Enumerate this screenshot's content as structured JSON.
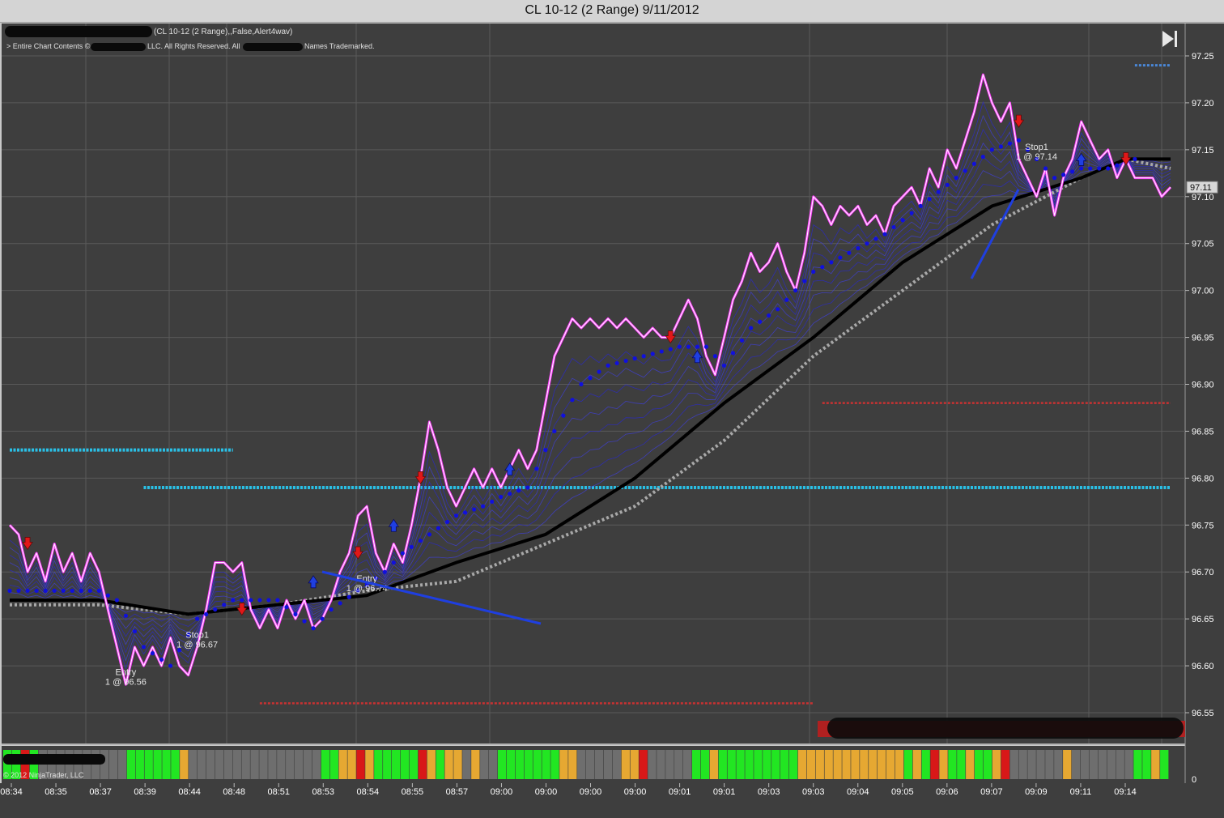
{
  "window": {
    "title": "CL 10-12 (2 Range)  9/11/2012"
  },
  "header": {
    "indicator_text": "(CL 10-12 (2 Range),,False,Alert4wav)",
    "copyright_left": "> Entire Chart Contents ©",
    "copyright_mid": "LLC. All Rights Reserved. All",
    "copyright_right": "Names Trademarked.",
    "ninjatrader_copyright": "© 2012 NinjaTrader, LLC"
  },
  "controls": {
    "jump_to_end_icon": "skip-to-end-icon"
  },
  "colors": {
    "panel_bg": "#3e3e3e",
    "price_line": "#ff3cff",
    "ma_black": "#000000",
    "ma_gray": "#a8a8a8",
    "dots_blue": "#1010dd",
    "level_cyan": "#2ac0e6",
    "level_red": "#c83232",
    "arrow_up": "#1f3fe0",
    "arrow_down": "#e01818",
    "bar_green": "#22e622",
    "bar_orange": "#e6a832",
    "bar_red": "#d81818",
    "bar_gray": "#6e6e6e"
  },
  "chart_data": {
    "type": "line",
    "title": "CL 10-12 (2 Range)  9/11/2012",
    "y_axis": {
      "ticks": [
        "97.25",
        "97.20",
        "97.15",
        "97.10",
        "97.05",
        "97.00",
        "96.95",
        "96.90",
        "96.85",
        "96.80",
        "96.75",
        "96.70",
        "96.65",
        "96.60",
        "96.55"
      ],
      "range": [
        96.52,
        97.27
      ],
      "last_price_label": "97.11"
    },
    "x_axis": {
      "ticks": [
        "08:34",
        "08:35",
        "08:37",
        "08:39",
        "08:44",
        "08:48",
        "08:51",
        "08:53",
        "08:54",
        "08:55",
        "08:57",
        "09:00",
        "09:00",
        "09:00",
        "09:00",
        "09:01",
        "09:01",
        "09:03",
        "09:03",
        "09:04",
        "09:05",
        "09:06",
        "09:07",
        "09:09",
        "09:11",
        "09:14"
      ]
    },
    "indicator_axis_label": "0",
    "series": [
      {
        "name": "price",
        "points": [
          [
            0,
            96.75
          ],
          [
            1,
            96.74
          ],
          [
            2,
            96.7
          ],
          [
            3,
            96.72
          ],
          [
            4,
            96.69
          ],
          [
            5,
            96.73
          ],
          [
            6,
            96.7
          ],
          [
            7,
            96.72
          ],
          [
            8,
            96.69
          ],
          [
            9,
            96.72
          ],
          [
            10,
            96.7
          ],
          [
            11,
            96.66
          ],
          [
            12,
            96.62
          ],
          [
            13,
            96.58
          ],
          [
            14,
            96.62
          ],
          [
            15,
            96.6
          ],
          [
            16,
            96.62
          ],
          [
            17,
            96.6
          ],
          [
            18,
            96.63
          ],
          [
            19,
            96.6
          ],
          [
            20,
            96.59
          ],
          [
            21,
            96.62
          ],
          [
            22,
            96.66
          ],
          [
            23,
            96.71
          ],
          [
            24,
            96.71
          ],
          [
            25,
            96.7
          ],
          [
            26,
            96.71
          ],
          [
            27,
            96.66
          ],
          [
            28,
            96.64
          ],
          [
            29,
            96.66
          ],
          [
            30,
            96.64
          ],
          [
            31,
            96.67
          ],
          [
            32,
            96.65
          ],
          [
            33,
            96.67
          ],
          [
            34,
            96.64
          ],
          [
            35,
            96.65
          ],
          [
            36,
            96.67
          ],
          [
            37,
            96.7
          ],
          [
            38,
            96.72
          ],
          [
            39,
            96.76
          ],
          [
            40,
            96.77
          ],
          [
            41,
            96.72
          ],
          [
            42,
            96.7
          ],
          [
            43,
            96.73
          ],
          [
            44,
            96.71
          ],
          [
            45,
            96.75
          ],
          [
            46,
            96.8
          ],
          [
            47,
            96.86
          ],
          [
            48,
            96.83
          ],
          [
            49,
            96.79
          ],
          [
            50,
            96.77
          ],
          [
            51,
            96.79
          ],
          [
            52,
            96.81
          ],
          [
            53,
            96.79
          ],
          [
            54,
            96.81
          ],
          [
            55,
            96.79
          ],
          [
            56,
            96.81
          ],
          [
            57,
            96.83
          ],
          [
            58,
            96.81
          ],
          [
            59,
            96.83
          ],
          [
            60,
            96.88
          ],
          [
            61,
            96.93
          ],
          [
            62,
            96.95
          ],
          [
            63,
            96.97
          ],
          [
            64,
            96.96
          ],
          [
            65,
            96.97
          ],
          [
            66,
            96.96
          ],
          [
            67,
            96.97
          ],
          [
            68,
            96.96
          ],
          [
            69,
            96.97
          ],
          [
            70,
            96.96
          ],
          [
            71,
            96.95
          ],
          [
            72,
            96.96
          ],
          [
            73,
            96.95
          ],
          [
            74,
            96.95
          ],
          [
            75,
            96.97
          ],
          [
            76,
            96.99
          ],
          [
            77,
            96.97
          ],
          [
            78,
            96.93
          ],
          [
            79,
            96.91
          ],
          [
            80,
            96.95
          ],
          [
            81,
            96.99
          ],
          [
            82,
            97.01
          ],
          [
            83,
            97.04
          ],
          [
            84,
            97.02
          ],
          [
            85,
            97.03
          ],
          [
            86,
            97.05
          ],
          [
            87,
            97.02
          ],
          [
            88,
            97.0
          ],
          [
            89,
            97.04
          ],
          [
            90,
            97.1
          ],
          [
            91,
            97.09
          ],
          [
            92,
            97.07
          ],
          [
            93,
            97.09
          ],
          [
            94,
            97.08
          ],
          [
            95,
            97.09
          ],
          [
            96,
            97.07
          ],
          [
            97,
            97.08
          ],
          [
            98,
            97.06
          ],
          [
            99,
            97.09
          ],
          [
            100,
            97.1
          ],
          [
            101,
            97.11
          ],
          [
            102,
            97.09
          ],
          [
            103,
            97.13
          ],
          [
            104,
            97.11
          ],
          [
            105,
            97.15
          ],
          [
            106,
            97.13
          ],
          [
            107,
            97.16
          ],
          [
            108,
            97.19
          ],
          [
            109,
            97.23
          ],
          [
            110,
            97.2
          ],
          [
            111,
            97.18
          ],
          [
            112,
            97.2
          ],
          [
            113,
            97.14
          ],
          [
            114,
            97.12
          ],
          [
            115,
            97.1
          ],
          [
            116,
            97.13
          ],
          [
            117,
            97.08
          ],
          [
            118,
            97.12
          ],
          [
            119,
            97.14
          ],
          [
            120,
            97.18
          ],
          [
            121,
            97.16
          ],
          [
            122,
            97.14
          ],
          [
            123,
            97.15
          ],
          [
            124,
            97.12
          ],
          [
            125,
            97.14
          ],
          [
            126,
            97.12
          ],
          [
            127,
            97.12
          ],
          [
            128,
            97.12
          ],
          [
            129,
            97.1
          ],
          [
            130,
            97.11
          ]
        ]
      },
      {
        "name": "ma_black",
        "points": [
          [
            0,
            96.67
          ],
          [
            10,
            96.67
          ],
          [
            20,
            96.655
          ],
          [
            30,
            96.665
          ],
          [
            40,
            96.675
          ],
          [
            50,
            96.71
          ],
          [
            60,
            96.74
          ],
          [
            70,
            96.8
          ],
          [
            80,
            96.88
          ],
          [
            90,
            96.95
          ],
          [
            100,
            97.03
          ],
          [
            110,
            97.09
          ],
          [
            120,
            97.12
          ],
          [
            125,
            97.14
          ],
          [
            130,
            97.14
          ]
        ]
      },
      {
        "name": "ma_gray",
        "points": [
          [
            0,
            96.665
          ],
          [
            10,
            96.665
          ],
          [
            20,
            96.655
          ],
          [
            30,
            96.665
          ],
          [
            40,
            96.68
          ],
          [
            50,
            96.69
          ],
          [
            60,
            96.73
          ],
          [
            70,
            96.77
          ],
          [
            80,
            96.84
          ],
          [
            90,
            96.93
          ],
          [
            100,
            97.0
          ],
          [
            110,
            97.07
          ],
          [
            120,
            97.12
          ],
          [
            125,
            97.14
          ],
          [
            130,
            97.13
          ]
        ]
      },
      {
        "name": "blue_trend_dots",
        "points": [
          [
            0,
            96.68
          ],
          [
            5,
            96.68
          ],
          [
            10,
            96.68
          ],
          [
            12,
            96.67
          ],
          [
            15,
            96.62
          ],
          [
            18,
            96.6
          ],
          [
            21,
            96.65
          ],
          [
            25,
            96.67
          ],
          [
            30,
            96.67
          ],
          [
            34,
            96.64
          ],
          [
            36,
            96.66
          ],
          [
            39,
            96.68
          ],
          [
            42,
            96.7
          ],
          [
            44,
            96.72
          ],
          [
            47,
            96.74
          ],
          [
            50,
            96.76
          ],
          [
            53,
            96.77
          ],
          [
            55,
            96.78
          ],
          [
            58,
            96.79
          ],
          [
            61,
            96.85
          ],
          [
            64,
            96.9
          ],
          [
            67,
            96.92
          ],
          [
            71,
            96.93
          ],
          [
            75,
            96.94
          ],
          [
            78,
            96.94
          ],
          [
            80,
            96.92
          ],
          [
            83,
            96.96
          ],
          [
            86,
            96.98
          ],
          [
            90,
            97.02
          ],
          [
            94,
            97.04
          ],
          [
            98,
            97.06
          ],
          [
            102,
            97.09
          ],
          [
            106,
            97.12
          ],
          [
            110,
            97.15
          ],
          [
            113,
            97.16
          ],
          [
            117,
            97.12
          ],
          [
            120,
            97.13
          ],
          [
            123,
            97.13
          ],
          [
            126,
            97.14
          ]
        ]
      }
    ],
    "levels": [
      {
        "name": "cyan_upper",
        "value": 96.83,
        "x_from": 0,
        "x_to": 25
      },
      {
        "name": "cyan_main",
        "value": 96.79,
        "x_from": 15,
        "x_to": 130
      },
      {
        "name": "red_upper",
        "value": 96.88,
        "x_from": 91,
        "x_to": 130
      },
      {
        "name": "red_lower",
        "value": 96.56,
        "x_from": 28,
        "x_to": 90
      },
      {
        "name": "blue_top",
        "value": 97.24,
        "x_from": 126,
        "x_to": 130
      }
    ],
    "signals": [
      {
        "type": "down",
        "x": 2,
        "y": 96.73
      },
      {
        "type": "down",
        "x": 26,
        "y": 96.66
      },
      {
        "type": "down",
        "x": 39,
        "y": 96.72
      },
      {
        "type": "up",
        "x": 43,
        "y": 96.75
      },
      {
        "type": "down",
        "x": 46,
        "y": 96.8
      },
      {
        "type": "up",
        "x": 34,
        "y": 96.69
      },
      {
        "type": "up",
        "x": 56,
        "y": 96.81
      },
      {
        "type": "down",
        "x": 74,
        "y": 96.95
      },
      {
        "type": "up",
        "x": 77,
        "y": 96.93
      },
      {
        "type": "down",
        "x": 113,
        "y": 97.18
      },
      {
        "type": "up",
        "x": 120,
        "y": 97.14
      },
      {
        "type": "down",
        "x": 125,
        "y": 97.14
      }
    ],
    "annotations": [
      {
        "line1": "Entry",
        "line2": "1 @ 96.56",
        "x": 13,
        "y": 96.59
      },
      {
        "line1": "Stop1",
        "line2": "1 @ 96.67",
        "x": 21,
        "y": 96.63
      },
      {
        "line1": "Entry",
        "line2": "1 @ 96.74",
        "x": 40,
        "y": 96.69
      },
      {
        "line1": "Stop1",
        "line2": "1 @ 97.14",
        "x": 115,
        "y": 97.15
      }
    ],
    "indicator_bars": [
      "green",
      "green",
      "red",
      "green",
      "gray",
      "gray",
      "gray",
      "gray",
      "gray",
      "gray",
      "gray",
      "gray",
      "gray",
      "gray",
      "green",
      "green",
      "green",
      "green",
      "green",
      "green",
      "orange",
      "gray",
      "gray",
      "gray",
      "gray",
      "gray",
      "gray",
      "gray",
      "gray",
      "gray",
      "gray",
      "gray",
      "gray",
      "gray",
      "gray",
      "gray",
      "green",
      "green",
      "orange",
      "orange",
      "red",
      "orange",
      "green",
      "green",
      "green",
      "green",
      "green",
      "red",
      "orange",
      "green",
      "orange",
      "orange",
      "gray",
      "orange",
      "gray",
      "gray",
      "green",
      "green",
      "green",
      "green",
      "green",
      "green",
      "green",
      "orange",
      "orange",
      "gray",
      "gray",
      "gray",
      "gray",
      "gray",
      "orange",
      "orange",
      "red",
      "gray",
      "gray",
      "gray",
      "gray",
      "gray",
      "green",
      "green",
      "orange",
      "green",
      "green",
      "green",
      "green",
      "green",
      "green",
      "green",
      "green",
      "green",
      "orange",
      "orange",
      "orange",
      "orange",
      "orange",
      "orange",
      "orange",
      "orange",
      "orange",
      "orange",
      "orange",
      "orange",
      "green",
      "orange",
      "green",
      "red",
      "orange",
      "green",
      "green",
      "orange",
      "green",
      "green",
      "orange",
      "red",
      "gray",
      "gray",
      "gray",
      "gray",
      "gray",
      "gray",
      "orange",
      "gray",
      "gray",
      "gray",
      "gray",
      "gray",
      "gray",
      "gray",
      "green",
      "green",
      "orange",
      "green"
    ]
  }
}
